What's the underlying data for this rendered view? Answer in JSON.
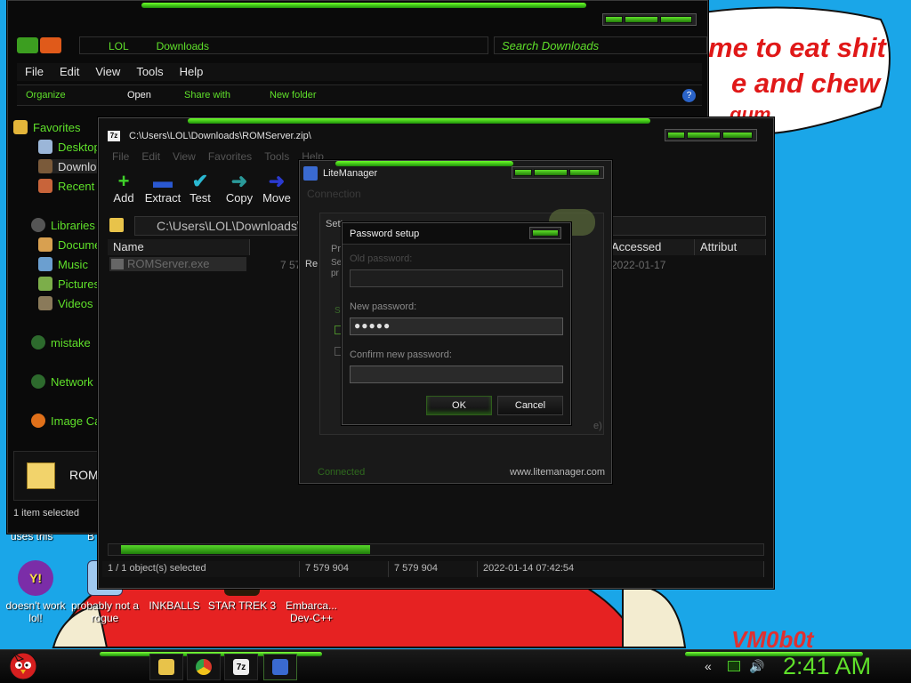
{
  "wallpaper": {
    "speech_lines": [
      "me to eat shit",
      "e and chew",
      "gum"
    ],
    "signature": "VM0b0t"
  },
  "desktop": {
    "orphan_labels": [
      "uses this",
      "B"
    ],
    "icons": [
      {
        "label": "doesn't work lol!",
        "icon": "yahoo-messenger-icon"
      },
      {
        "label": "probably not a rogue",
        "icon": "shortcut-icon"
      },
      {
        "label": "INKBALLS",
        "icon": "inkballs-icon"
      },
      {
        "label": "STAR TREK 3",
        "icon": "star-wars-icon"
      },
      {
        "label": "Embarca... Dev-C++",
        "icon": "dev-cpp-icon"
      }
    ]
  },
  "explorer": {
    "breadcrumb": [
      "LOL",
      "Downloads"
    ],
    "search_placeholder": "Search Downloads",
    "menu": [
      "File",
      "Edit",
      "View",
      "Tools",
      "Help"
    ],
    "commands": [
      "Organize",
      "Open",
      "Share with",
      "New folder"
    ],
    "nav": {
      "favorites": "Favorites",
      "desktop": "Desktop",
      "downloads": "Downloads",
      "recent": "Recent",
      "libraries": "Libraries",
      "documents": "Documents",
      "music": "Music",
      "pictures": "Pictures",
      "videos": "Videos",
      "mistake": "mistake",
      "network": "Network",
      "image_capture": "Image Ca"
    },
    "details_name": "ROM",
    "status": "1 item selected"
  },
  "zip": {
    "title": "C:\\Users\\LOL\\Downloads\\ROMServer.zip\\",
    "menu": [
      "File",
      "Edit",
      "View",
      "Favorites",
      "Tools",
      "Help"
    ],
    "tools": [
      "Add",
      "Extract",
      "Test",
      "Copy",
      "Move"
    ],
    "path": "C:\\Users\\LOL\\Downloads\\R",
    "columns": [
      "Name",
      "Accessed",
      "Attribut"
    ],
    "file": {
      "name": "ROMServer.exe",
      "size_partial": "7 57",
      "accessed": "2022-01-17"
    },
    "status": {
      "selected": "1 / 1 object(s) selected",
      "size": "7 579 904",
      "packed": "7 579 904",
      "modified": "2022-01-14 07:42:54"
    }
  },
  "litemanager": {
    "title": "LiteManager",
    "tab": "Connection",
    "status": "Connected",
    "website": "www.litemanager.com",
    "fragments": [
      "Sett",
      "Pr",
      "Se",
      "pr",
      "Re",
      "S",
      "e)"
    ]
  },
  "password_dialog": {
    "title": "Password setup",
    "old_label": "Old password:",
    "old_value": "",
    "new_label": "New password:",
    "new_value": "●●●●●",
    "confirm_label": "Confirm new password:",
    "confirm_value": "",
    "ok": "OK",
    "cancel": "Cancel"
  },
  "taskbar": {
    "items": [
      "explorer-taskbar-icon",
      "chrome-taskbar-icon",
      "7zip-taskbar-icon",
      "litemanager-taskbar-icon"
    ],
    "clock": "2:41 AM"
  },
  "colors": {
    "accent": "#5fe02a",
    "wallpaper_blue": "#1aa6e8",
    "wallpaper_red": "#e01818"
  }
}
